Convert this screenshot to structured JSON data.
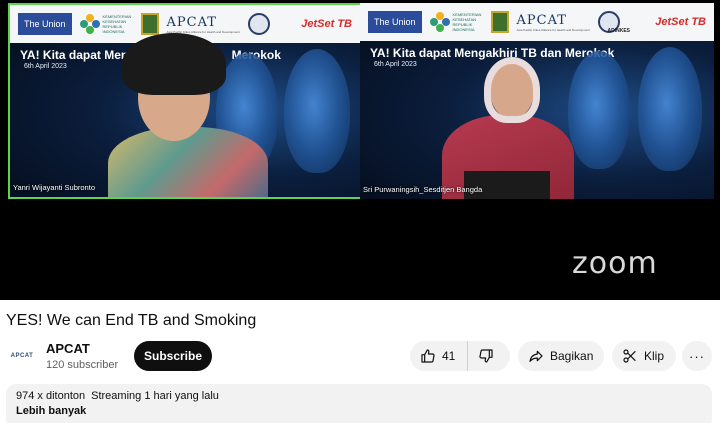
{
  "player": {
    "banner_left": {
      "union_logo": "The Union",
      "kemenkes_text": "KEMENTERIAN KESEHATAN REPUBLIK INDONESIA",
      "apcat_logo": "APCAT",
      "apcat_sub": "Asia Pacific Cities Alliance for Health and Development",
      "jetset_logo": "JetSet TB"
    },
    "banner_right": {
      "union_logo": "The Union",
      "kemenkes_text": "KEMENTERIAN KESEHATAN REPUBLIK INDONESIA",
      "apcat_logo": "APCAT",
      "apcat_sub": "Asia Pacific Cities Alliance for Health and Development",
      "adinkes_logo": "ADINKES",
      "jetset_logo": "JetSet TB"
    },
    "left_headline": "YA! Kita dapat Meng",
    "left_headline_tail": "Merokok",
    "right_headline": "YA! Kita dapat Mengakhiri TB dan Merokok",
    "date": "6th April 2023",
    "left_participant": "Yanri Wijayanti Subronto",
    "right_participant": "Sri Purwaningsih_Sesditjen Bangda",
    "watermark": "zoom"
  },
  "video": {
    "title": "YES! We can End TB and Smoking"
  },
  "channel": {
    "avatar_text": "APCAT",
    "name": "APCAT",
    "subscribers": "120 subscriber",
    "subscribe_label": "Subscribe"
  },
  "actions": {
    "like_count": "41",
    "share_label": "Bagikan",
    "clip_label": "Klip",
    "more_label": "···",
    "icons": [
      "thumbs-up-icon",
      "thumbs-down-icon",
      "share-icon",
      "scissors-icon",
      "more-horizontal-icon"
    ]
  },
  "description": {
    "views": "974 x ditonton",
    "streamed": "Streaming 1 hari yang lalu",
    "more_label": "Lebih banyak"
  },
  "colors": {
    "active_speaker_border": "#5fd34f",
    "subscribe_bg": "#0f0f0f",
    "pill_bg": "#f2f2f2",
    "jetset_red": "#d62a2a"
  }
}
